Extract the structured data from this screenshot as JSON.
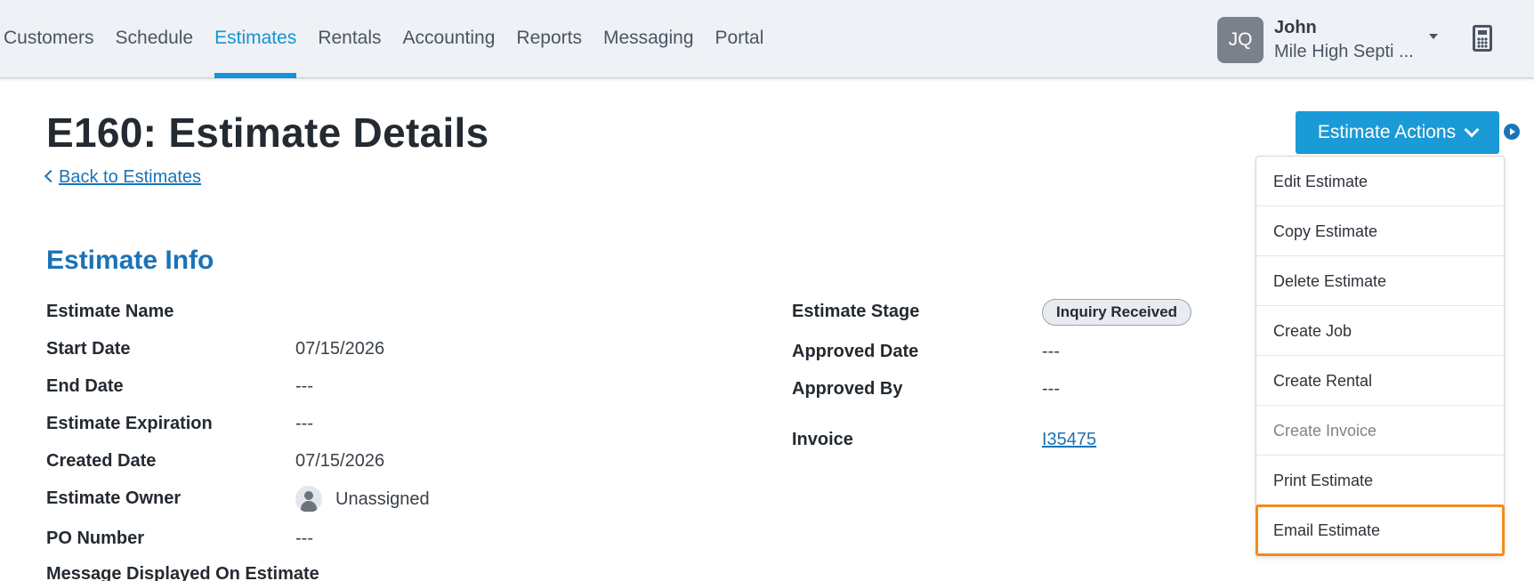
{
  "nav": {
    "items": [
      {
        "label": "Customers",
        "active": false
      },
      {
        "label": "Schedule",
        "active": false
      },
      {
        "label": "Estimates",
        "active": true
      },
      {
        "label": "Rentals",
        "active": false
      },
      {
        "label": "Accounting",
        "active": false
      },
      {
        "label": "Reports",
        "active": false
      },
      {
        "label": "Messaging",
        "active": false
      },
      {
        "label": "Portal",
        "active": false
      }
    ]
  },
  "user": {
    "initials": "JQ",
    "name": "John",
    "company": "Mile High Septi ..."
  },
  "page": {
    "title": "E160: Estimate Details",
    "back_label": "Back to Estimates",
    "section_title": "Estimate Info"
  },
  "fields_left": {
    "estimate_name": {
      "label": "Estimate Name",
      "value": ""
    },
    "start_date": {
      "label": "Start Date",
      "value": "07/15/2026"
    },
    "end_date": {
      "label": "End Date",
      "value": "---"
    },
    "expiration": {
      "label": "Estimate Expiration",
      "value": "---"
    },
    "created_date": {
      "label": "Created Date",
      "value": "07/15/2026"
    },
    "owner": {
      "label": "Estimate Owner",
      "value": "Unassigned"
    },
    "po_number": {
      "label": "PO Number",
      "value": "---"
    },
    "message": {
      "label": "Message Displayed On Estimate"
    }
  },
  "fields_right": {
    "stage": {
      "label": "Estimate Stage",
      "value": "Inquiry Received"
    },
    "approved_date": {
      "label": "Approved Date",
      "value": "---"
    },
    "approved_by": {
      "label": "Approved By",
      "value": "---"
    },
    "invoice": {
      "label": "Invoice",
      "value": "I35475"
    }
  },
  "actions": {
    "button_label": "Estimate Actions",
    "menu": [
      {
        "label": "Edit Estimate",
        "disabled": false
      },
      {
        "label": "Copy Estimate",
        "disabled": false
      },
      {
        "label": "Delete Estimate",
        "disabled": false
      },
      {
        "label": "Create Job",
        "disabled": false
      },
      {
        "label": "Create Rental",
        "disabled": false
      },
      {
        "label": "Create Invoice",
        "disabled": true
      },
      {
        "label": "Print Estimate",
        "disabled": false
      },
      {
        "label": "Email Estimate",
        "disabled": false,
        "highlighted": true
      }
    ]
  },
  "colors": {
    "accent": "#1593d4",
    "link": "#1a73b7",
    "highlight": "#f28c1a"
  }
}
